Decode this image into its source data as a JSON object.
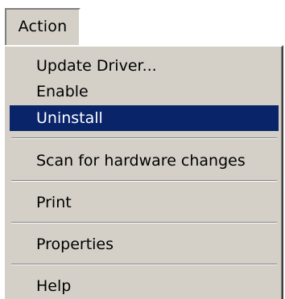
{
  "menubar": {
    "title": "Action"
  },
  "menu": {
    "items": [
      {
        "label": "Update Driver...",
        "selected": false
      },
      {
        "label": "Enable",
        "selected": false
      },
      {
        "label": "Uninstall",
        "selected": true
      },
      {
        "label": "Scan for hardware changes",
        "selected": false
      },
      {
        "label": "Print",
        "selected": false
      },
      {
        "label": "Properties",
        "selected": false
      },
      {
        "label": "Help",
        "selected": false
      }
    ]
  },
  "colors": {
    "menu_background": "#d4d0c8",
    "selection_background": "#0a246a",
    "selection_text": "#ffffff",
    "text": "#000000"
  }
}
